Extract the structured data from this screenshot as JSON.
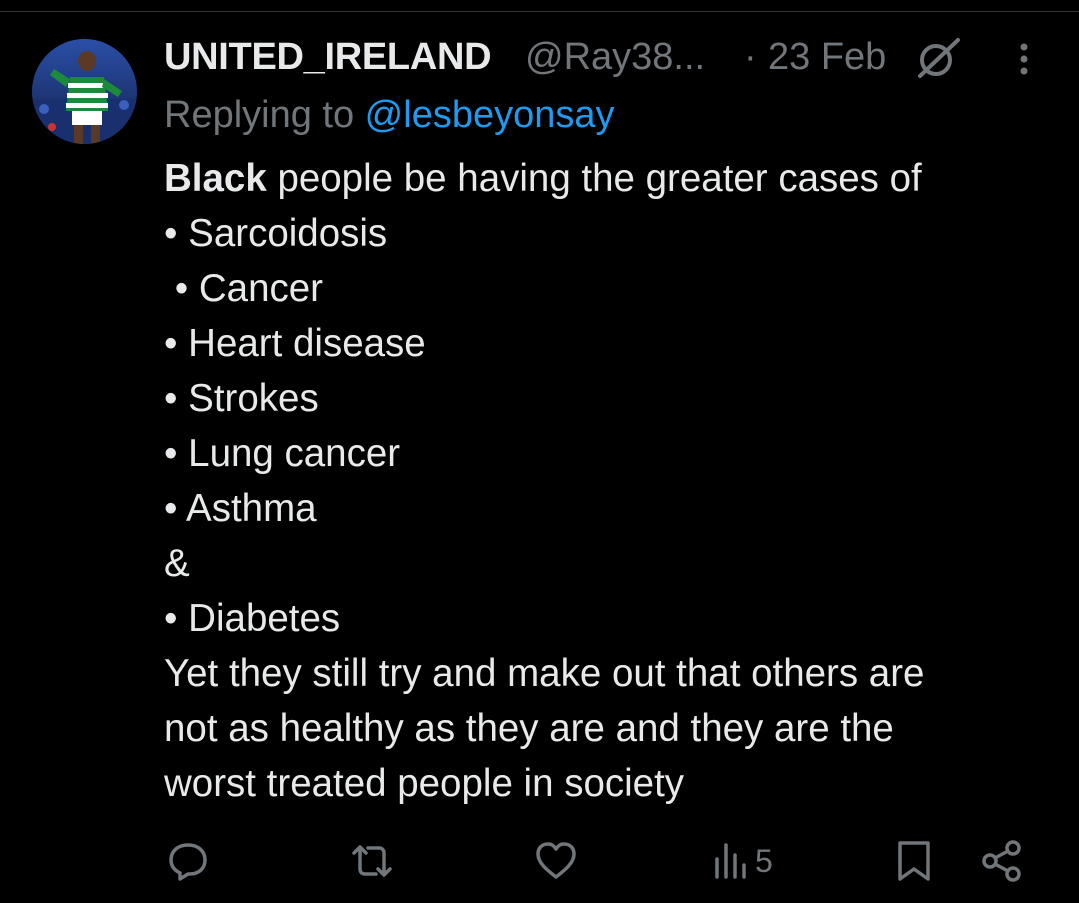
{
  "author": {
    "display_name": "UNITED_IRELAND",
    "handle": "@Ray38...",
    "separator": "·",
    "date": "23 Feb"
  },
  "reply": {
    "prefix": "Replying to ",
    "mention": "@lesbeyonsay"
  },
  "body": {
    "intro_bold": "Black",
    "intro_rest": " people be having the greater cases of",
    "items": [
      "• Sarcoidosis",
      " • Cancer",
      "• Heart disease",
      "• Strokes",
      "• Lung cancer",
      "• Asthma",
      "&",
      "• Diabetes"
    ],
    "closing_lines": [
      "Yet they still try and make out that others are",
      "not as healthy as they are and they are the",
      "worst treated people in society"
    ]
  },
  "actions": {
    "views_count": "5"
  },
  "icons": {
    "avatar": "avatar-photo",
    "grok": "grok-icon",
    "more": "more-icon",
    "reply": "reply-icon",
    "retweet": "retweet-icon",
    "like": "like-icon",
    "views": "views-icon",
    "bookmark": "bookmark-icon",
    "share": "share-icon"
  },
  "colors": {
    "background": "#000000",
    "text_primary": "#e7e9ea",
    "text_secondary": "#71767b",
    "accent": "#1d9bf0",
    "divider": "#2f3336"
  }
}
